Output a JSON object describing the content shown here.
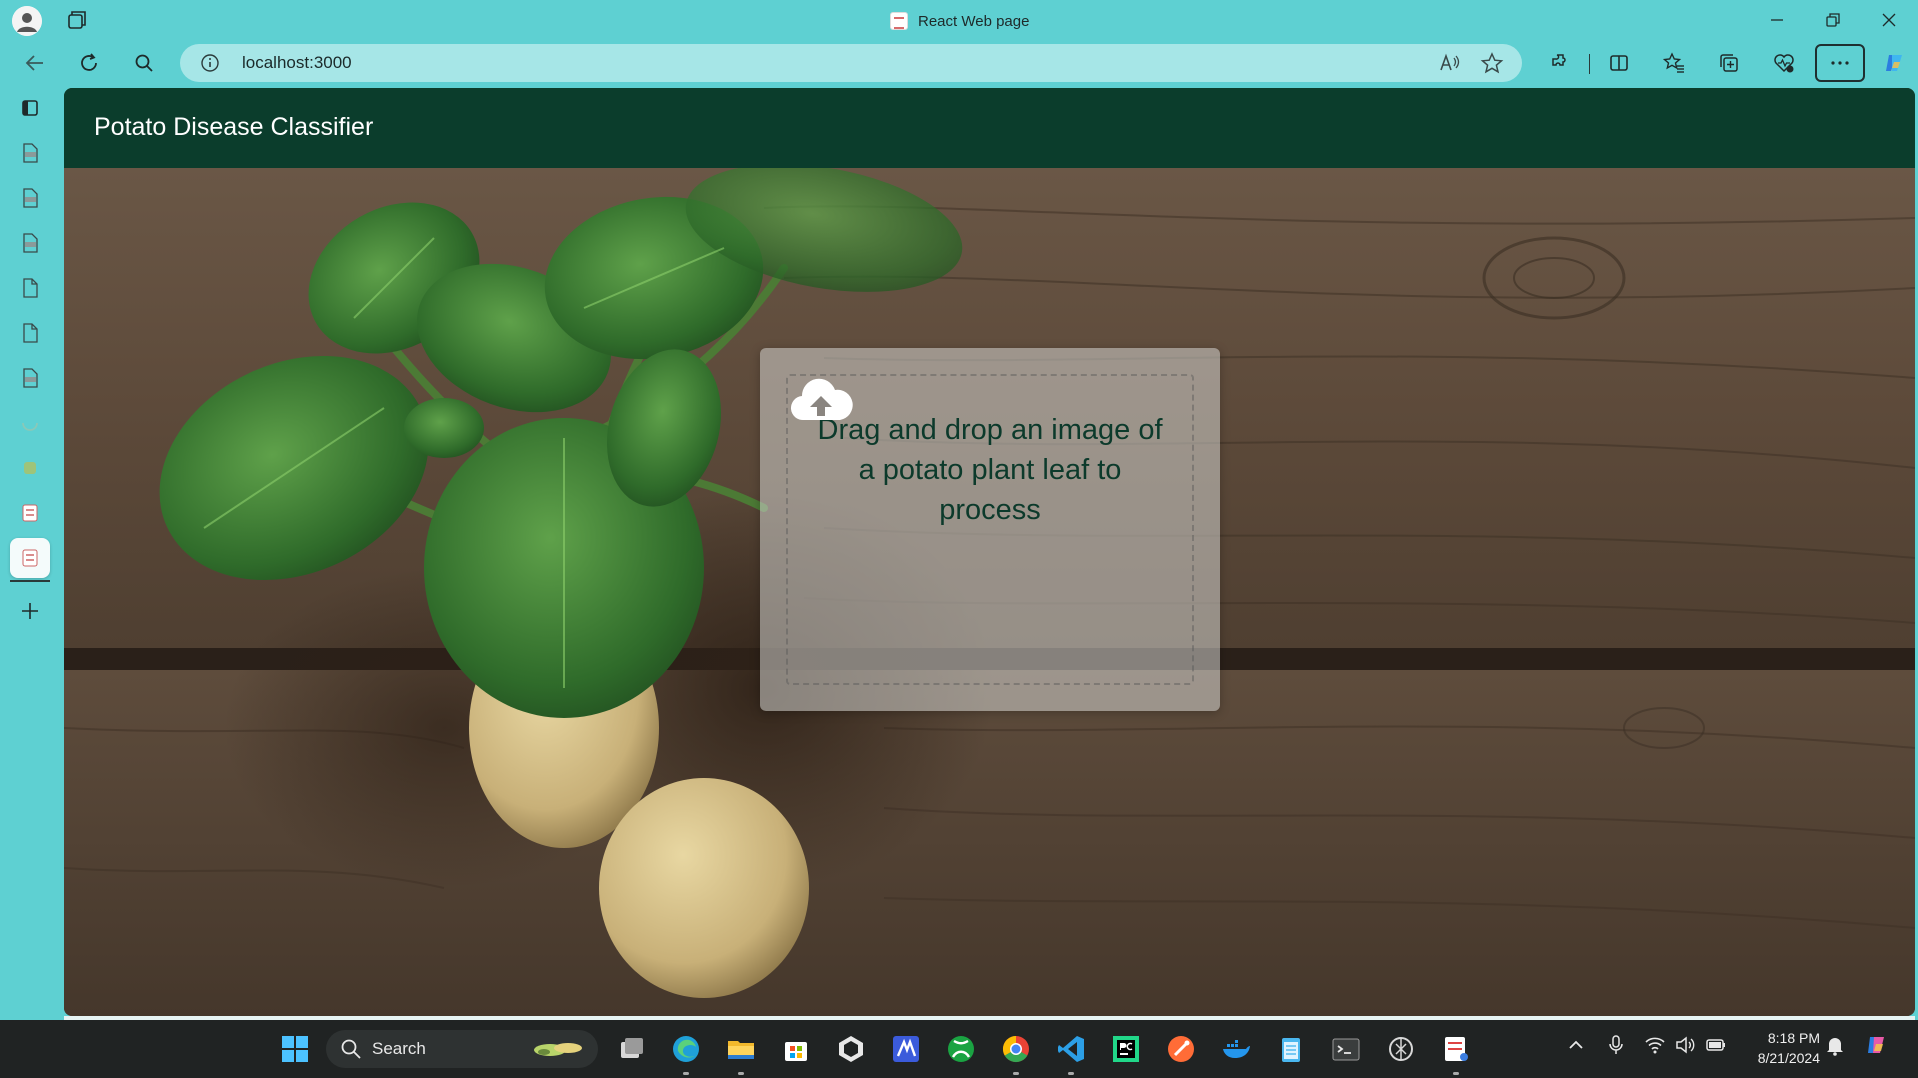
{
  "window": {
    "title": "React Web page"
  },
  "toolbar": {
    "url": "localhost:3000"
  },
  "app": {
    "title": "Potato Disease Classifier",
    "dropzone_text": "Drag and drop an image of a potato plant leaf to process"
  },
  "taskbar": {
    "search_label": "Search",
    "time": "8:18 PM",
    "date": "8/21/2024"
  },
  "colors": {
    "browser_chrome": "#5ed0d2",
    "app_bar": "#0b3d2c",
    "dropzone_text": "#0c3a2b",
    "taskbar": "#202323"
  },
  "icons": {
    "titlebar": [
      "profile-avatar-icon",
      "workspaces-icon",
      "minimize-icon",
      "restore-icon",
      "close-icon"
    ],
    "toolbar": [
      "back-icon",
      "refresh-icon",
      "search-icon",
      "info-icon",
      "read-aloud-icon",
      "favorite-star-icon",
      "extensions-icon",
      "split-screen-icon",
      "favorites-icon",
      "collections-icon",
      "browser-essentials-icon",
      "more-icon",
      "copilot-icon"
    ],
    "sidebar": [
      "tab-actions-icon",
      "pdf-tab-icon",
      "pdf-tab-icon",
      "pdf-tab-icon",
      "document-tab-icon",
      "document-tab-icon",
      "pdf-tab-icon",
      "loading-tab-icon",
      "tab-favicon-icon",
      "tab-favicon-icon",
      "active-tab-favicon-icon",
      "new-tab-icon"
    ],
    "taskbar": [
      "windows-start-icon",
      "task-view-icon",
      "edge-icon",
      "file-explorer-icon",
      "microsoft-store-icon",
      "unity-icon",
      "visual-studio-icon",
      "xbox-icon",
      "chrome-icon",
      "vscode-icon",
      "pycharm-icon",
      "postman-icon",
      "docker-icon",
      "notepad-icon",
      "terminal-icon",
      "openai-icon",
      "snipping-tool-icon"
    ]
  }
}
